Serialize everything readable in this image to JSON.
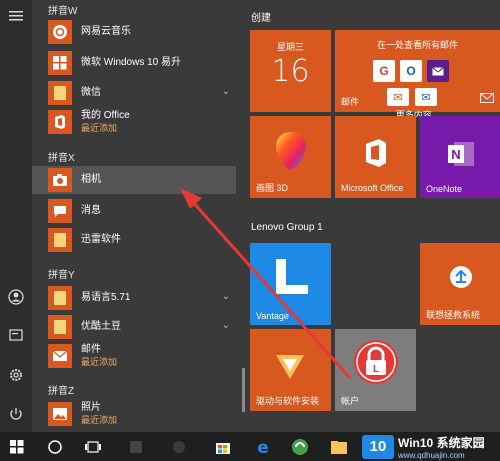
{
  "rail": {
    "icons": [
      "hamburger-icon",
      "user-icon",
      "document-icon",
      "settings-icon",
      "power-icon"
    ]
  },
  "applist": {
    "groups": {
      "w": "拼音W",
      "x": "拼音X",
      "y": "拼音Y",
      "z": "拼音Z"
    },
    "apps": {
      "netease": {
        "label": "网易云音乐"
      },
      "win10upgrade": {
        "label": "微软 Windows 10 易升"
      },
      "wechat": {
        "label": "微信"
      },
      "myoffice": {
        "label": "我的 Office",
        "sub": "最近添加"
      },
      "camera": {
        "label": "相机"
      },
      "messages": {
        "label": "消息"
      },
      "thunder": {
        "label": "迅雷软件"
      },
      "yiyin": {
        "label": "易语言5.71"
      },
      "youku": {
        "label": "优酷土豆"
      },
      "mail": {
        "label": "邮件",
        "sub": "最近添加"
      },
      "photos": {
        "label": "照片",
        "sub": "最近添加"
      }
    }
  },
  "tiles": {
    "sections": {
      "create": "创建",
      "lenovo": "Lenovo Group 1"
    },
    "calendar": {
      "weekday": "星期三",
      "day": "16"
    },
    "mail": {
      "top": "在一处查看所有邮件",
      "more": "更多内容...",
      "label": "邮件"
    },
    "paint3d": {
      "label": "画图 3D"
    },
    "office": {
      "label": "Microsoft Office"
    },
    "onenote": {
      "label": "OneNote"
    },
    "vantage": {
      "label": "Vantage"
    },
    "lenovo_rescue": {
      "label": "联想拯救系统"
    },
    "drivers": {
      "label": "驱动与软件安装"
    },
    "account": {
      "label": "帐户"
    }
  },
  "watermark": {
    "badge": "10",
    "title": "Win10 系统家园",
    "url": "www.qdhuajin.com"
  },
  "colors": {
    "tile_orange": "#d9581f",
    "onenote_purple": "#7719aa",
    "selected_row": "#555555",
    "arrow_red": "#e53935"
  }
}
